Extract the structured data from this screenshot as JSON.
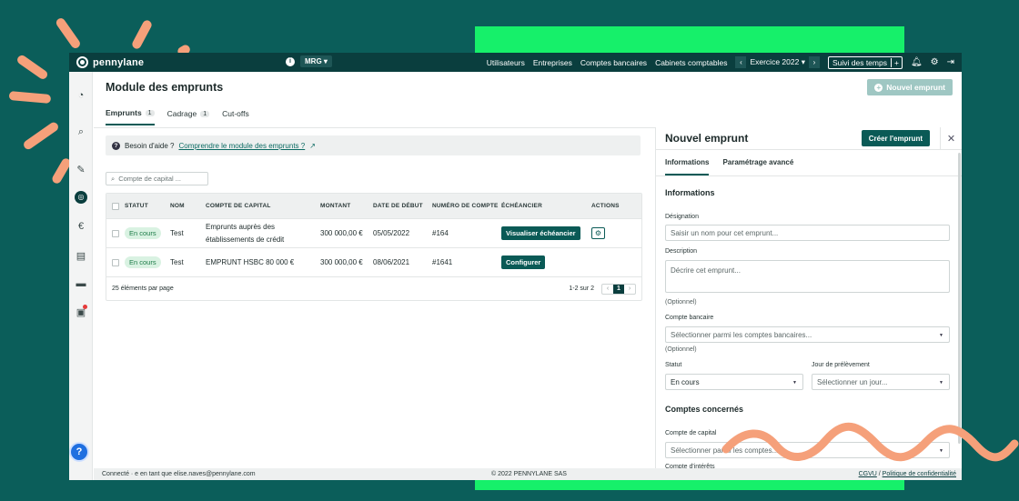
{
  "brand": {
    "name": "pennylane"
  },
  "topbar": {
    "info": "i",
    "company": "MRG",
    "nav": [
      "Utilisateurs",
      "Entreprises",
      "Comptes bancaires",
      "Cabinets comptables"
    ],
    "prev": "‹",
    "next": "›",
    "exercice": "Exercice 2022",
    "suivi": "Suivi des temps",
    "plus": "+"
  },
  "page": {
    "title": "Module des emprunts",
    "new_button": "Nouvel emprunt",
    "tabs": [
      {
        "label": "Emprunts",
        "count": "1"
      },
      {
        "label": "Cadrage",
        "count": "1"
      },
      {
        "label": "Cut-offs",
        "count": ""
      }
    ],
    "help": {
      "question": "?",
      "text": "Besoin d'aide ?",
      "link": "Comprendre le module des emprunts ?"
    },
    "search_placeholder": "Compte de capital ..."
  },
  "table": {
    "headers": [
      "STATUT",
      "NOM",
      "COMPTE DE CAPITAL",
      "MONTANT",
      "DATE DE DÉBUT",
      "NUMÉRO DE COMPTE",
      "ÉCHÉANCIER",
      "ACTIONS"
    ],
    "rows": [
      {
        "statut": "En cours",
        "nom": "Test",
        "compte": "Emprunts auprès des établissements de crédit",
        "montant": "300 000,00 €",
        "date": "05/05/2022",
        "numero": "#164",
        "echeancier": "Visualiser échéancier",
        "action": "⚙"
      },
      {
        "statut": "En cours",
        "nom": "Test",
        "compte": "EMPRUNT HSBC 80 000 €",
        "montant": "300 000,00 €",
        "date": "08/06/2021",
        "numero": "#1641",
        "echeancier": "Configurer",
        "action": ""
      }
    ],
    "footer_left": "25 éléments par page",
    "range": "1-2 sur 2",
    "page": "1"
  },
  "panel": {
    "title": "Nouvel emprunt",
    "create": "Créer l'emprunt",
    "close": "✕",
    "tabs": [
      "Informations",
      "Paramétrage avancé"
    ],
    "section1": "Informations",
    "designation_label": "Désignation",
    "designation_placeholder": "Saisir un nom pour cet emprunt...",
    "description_label": "Description",
    "description_placeholder": "Décrire cet emprunt...",
    "optional": "(Optionnel)",
    "bank_label": "Compte bancaire",
    "bank_placeholder": "Sélectionner parmi les comptes bancaires...",
    "statut_label": "Statut",
    "statut_value": "En cours",
    "jour_label": "Jour de prélèvement",
    "jour_placeholder": "Sélectionner un jour...",
    "section2": "Comptes concernés",
    "capital_label": "Compte de capital",
    "capital_placeholder": "Sélectionner parmi les comptes...",
    "cut_label": "Compte d'intérêts"
  },
  "footer": {
    "left": "Connecté · e en tant que elise.naves@pennylane.com",
    "center": "© 2022 PENNYLANE SAS",
    "cgvu": "CGVU",
    "sep": " / ",
    "privacy": "Politique de confidentialité"
  },
  "colors": {
    "brand_dark": "#0a3e3e",
    "accent": "#0a5a56",
    "bg": "#0b5e5a",
    "green": "#16f06a",
    "salmon": "#f5a07a"
  }
}
